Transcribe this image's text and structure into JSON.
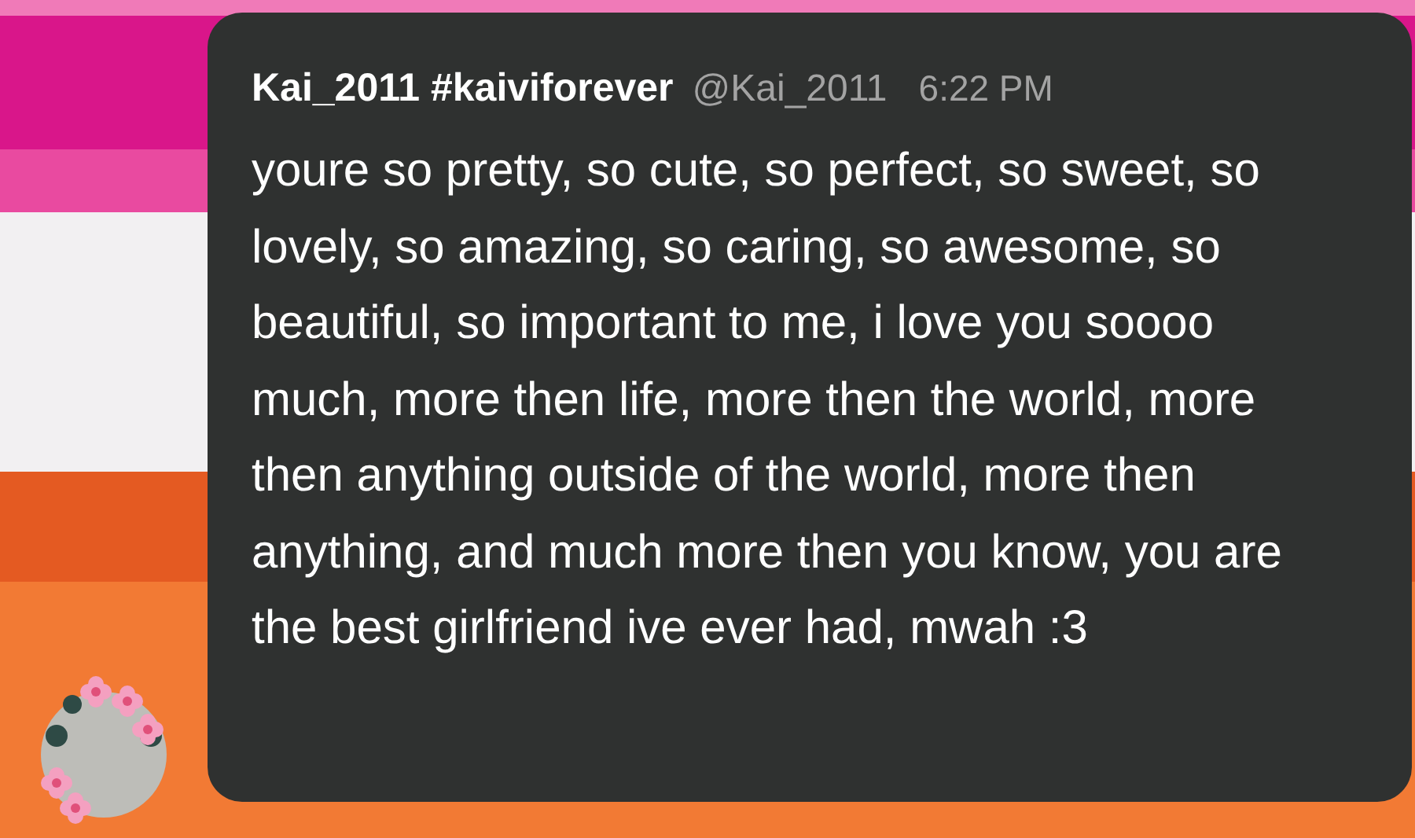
{
  "message": {
    "display_name": "Kai_2011 #kaiviforever",
    "handle": "@Kai_2011",
    "time": "6:22 PM",
    "text": "youre so pretty, so cute, so perfect, so sweet, so lovely, so amazing, so caring, so awesome, so beautiful, so important to me, i love you soooo much, more then life, more then the world, more then anything outside of the world, more then anything, and much more then you know, you are the best girlfriend ive ever had, mwah :3"
  }
}
